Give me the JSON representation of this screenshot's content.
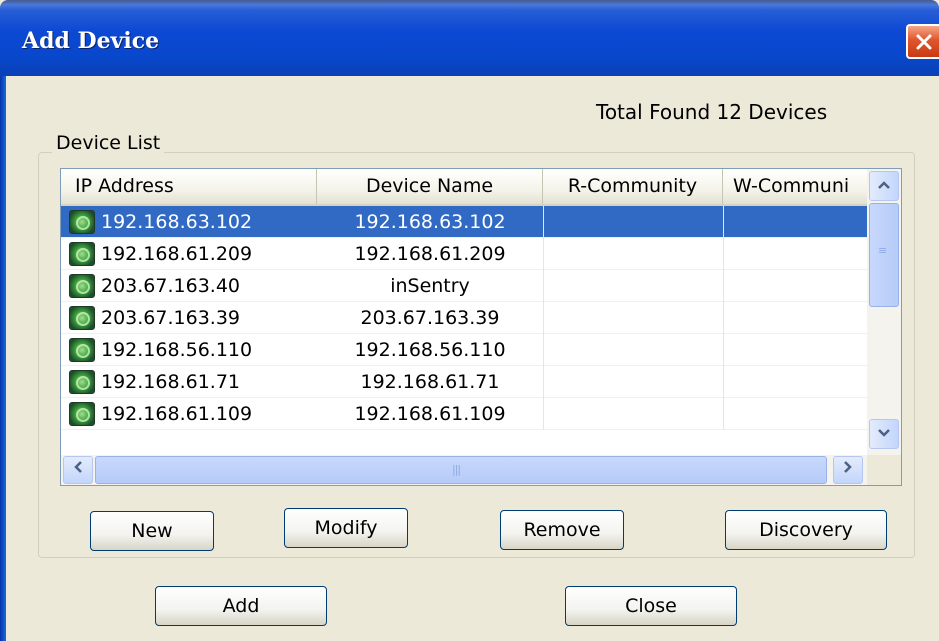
{
  "window": {
    "title": "Add Device"
  },
  "status": {
    "total_found": "Total Found 12 Devices"
  },
  "device_list": {
    "group_label": "Device List",
    "columns": [
      "IP Address",
      "Device Name",
      "R-Community",
      "W-Communi"
    ],
    "rows": [
      {
        "ip": "192.168.63.102",
        "name": "192.168.63.102",
        "r_community": "",
        "w_community": "",
        "selected": true
      },
      {
        "ip": "192.168.61.209",
        "name": "192.168.61.209",
        "r_community": "",
        "w_community": ""
      },
      {
        "ip": "203.67.163.40",
        "name": "inSentry",
        "r_community": "",
        "w_community": ""
      },
      {
        "ip": "203.67.163.39",
        "name": "203.67.163.39",
        "r_community": "",
        "w_community": ""
      },
      {
        "ip": "192.168.56.110",
        "name": "192.168.56.110",
        "r_community": "",
        "w_community": ""
      },
      {
        "ip": "192.168.61.71",
        "name": "192.168.61.71",
        "r_community": "",
        "w_community": ""
      },
      {
        "ip": "192.168.61.109",
        "name": "192.168.61.109",
        "r_community": "",
        "w_community": ""
      }
    ],
    "row_icon": "network-device-icon"
  },
  "buttons": {
    "new": "New",
    "modify": "Modify",
    "remove": "Remove",
    "discovery": "Discovery",
    "add": "Add",
    "close": "Close"
  },
  "colors": {
    "title_bar": "#0848cc",
    "selection": "#316ac5",
    "dialog_bg": "#ece9d8",
    "close_button": "#e0562b"
  }
}
